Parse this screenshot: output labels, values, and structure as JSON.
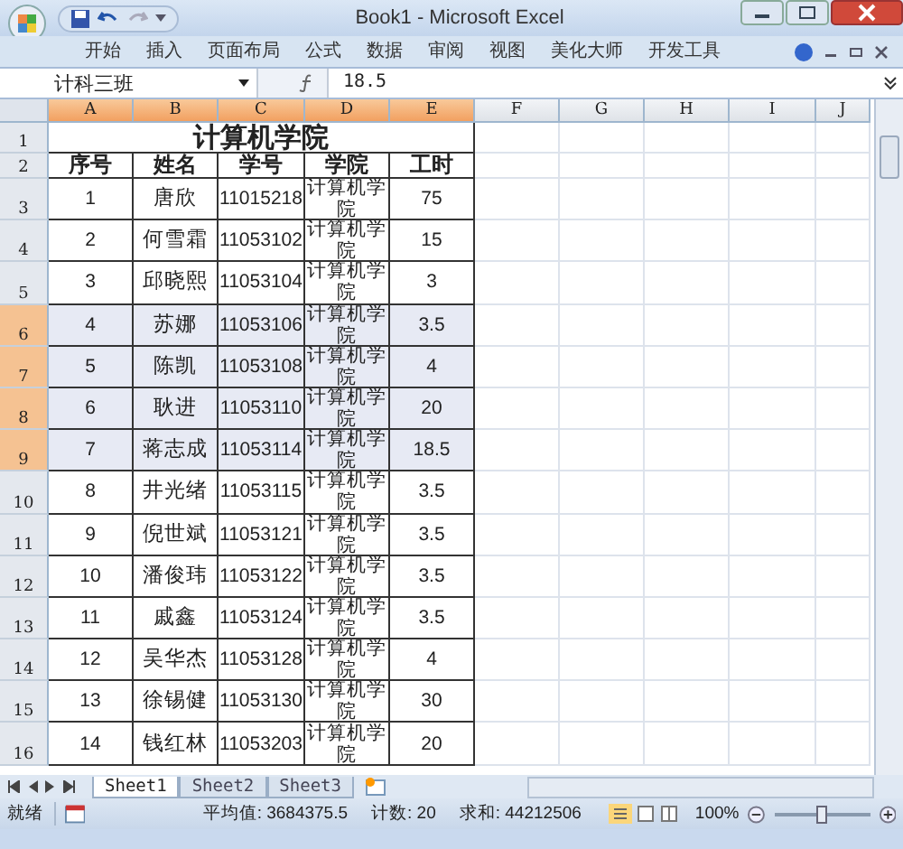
{
  "window": {
    "title": "Book1 - Microsoft Excel"
  },
  "ribbon_tabs": [
    {
      "label": "开始",
      "selected": false
    },
    {
      "label": "插入",
      "selected": false
    },
    {
      "label": "页面布局",
      "selected": false
    },
    {
      "label": "公式",
      "selected": false
    },
    {
      "label": "数据",
      "selected": false
    },
    {
      "label": "审阅",
      "selected": false
    },
    {
      "label": "视图",
      "selected": false
    },
    {
      "label": "美化大师",
      "selected": false
    },
    {
      "label": "开发工具",
      "selected": false
    }
  ],
  "name_box": {
    "value": "计科三班"
  },
  "formula_bar": {
    "value": "18.5"
  },
  "columns": [
    {
      "label": "A",
      "selected": true
    },
    {
      "label": "B",
      "selected": true
    },
    {
      "label": "C",
      "selected": true
    },
    {
      "label": "D",
      "selected": true
    },
    {
      "label": "E",
      "selected": true
    },
    {
      "label": "F",
      "selected": false
    },
    {
      "label": "G",
      "selected": false
    },
    {
      "label": "H",
      "selected": false
    },
    {
      "label": "I",
      "selected": false
    },
    {
      "label": "J",
      "selected": false
    }
  ],
  "rows": [
    {
      "number": "1",
      "kind": "title",
      "selected": false,
      "cells": [
        "计算机学院"
      ]
    },
    {
      "number": "2",
      "kind": "header",
      "selected": false,
      "cells": [
        "序号",
        "姓名",
        "学号",
        "学院",
        "工时"
      ]
    },
    {
      "number": "3",
      "kind": "data",
      "selected": false,
      "cells": [
        "1",
        "唐欣",
        "11015218",
        "计算机学院",
        "75"
      ]
    },
    {
      "number": "4",
      "kind": "data",
      "selected": false,
      "cells": [
        "2",
        "何雪霜",
        "11053102",
        "计算机学院",
        "15"
      ]
    },
    {
      "number": "5",
      "kind": "data",
      "selected": false,
      "cells": [
        "3",
        "邱晓熙",
        "11053104",
        "计算机学院",
        "3"
      ]
    },
    {
      "number": "6",
      "kind": "data",
      "selected": true,
      "cells": [
        "4",
        "苏娜",
        "11053106",
        "计算机学院",
        "3.5"
      ]
    },
    {
      "number": "7",
      "kind": "data",
      "selected": true,
      "cells": [
        "5",
        "陈凯",
        "11053108",
        "计算机学院",
        "4"
      ]
    },
    {
      "number": "8",
      "kind": "data",
      "selected": true,
      "cells": [
        "6",
        "耿进",
        "11053110",
        "计算机学院",
        "20"
      ]
    },
    {
      "number": "9",
      "kind": "data",
      "selected": true,
      "cells": [
        "7",
        "蒋志成",
        "11053114",
        "计算机学院",
        "18.5"
      ]
    },
    {
      "number": "10",
      "kind": "data",
      "selected": false,
      "cells": [
        "8",
        "井光绪",
        "11053115",
        "计算机学院",
        "3.5"
      ]
    },
    {
      "number": "11",
      "kind": "data",
      "selected": false,
      "cells": [
        "9",
        "倪世斌",
        "11053121",
        "计算机学院",
        "3.5"
      ]
    },
    {
      "number": "12",
      "kind": "data",
      "selected": false,
      "cells": [
        "10",
        "潘俊玮",
        "11053122",
        "计算机学院",
        "3.5"
      ]
    },
    {
      "number": "13",
      "kind": "data",
      "selected": false,
      "cells": [
        "11",
        "戚鑫",
        "11053124",
        "计算机学院",
        "3.5"
      ]
    },
    {
      "number": "14",
      "kind": "data",
      "selected": false,
      "cells": [
        "12",
        "吴华杰",
        "11053128",
        "计算机学院",
        "4"
      ]
    },
    {
      "number": "15",
      "kind": "data",
      "selected": false,
      "cells": [
        "13",
        "徐锡健",
        "11053130",
        "计算机学院",
        "30"
      ]
    },
    {
      "number": "16",
      "kind": "data",
      "selected": false,
      "cells": [
        "14",
        "钱红林",
        "11053203",
        "计算机学院",
        "20"
      ]
    }
  ],
  "sheet_tabs": [
    {
      "label": "Sheet1",
      "selected": true
    },
    {
      "label": "Sheet2",
      "selected": false
    },
    {
      "label": "Sheet3",
      "selected": false
    }
  ],
  "status_bar": {
    "mode": "就绪",
    "average": "平均值: 3684375.5",
    "count": "计数: 20",
    "sum": "求和: 44212506",
    "zoom": "100%"
  },
  "zoom_slider": {
    "level": 0.5
  }
}
